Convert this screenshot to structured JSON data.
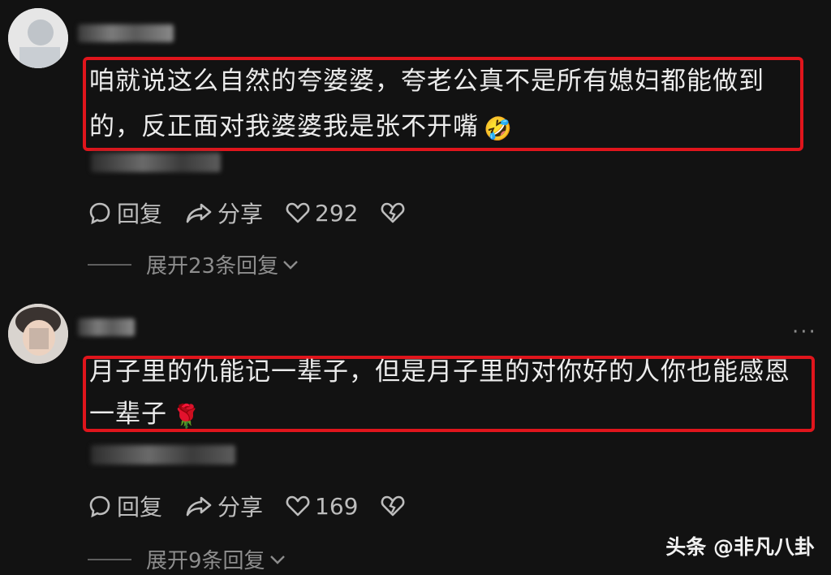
{
  "comments": [
    {
      "text_line1": "咱就说这么自然的夸婆婆，夸老公真不是所有媳妇都能做到",
      "text_line2": "的，反正面对我婆婆我是张不开嘴",
      "emoji": "🤣",
      "reply_label": "回复",
      "share_label": "分享",
      "likes": "292",
      "expand_replies": "展开23条回复"
    },
    {
      "text_line1": "月子里的仇能记一辈子，但是月子里的对你好的人你也能感恩",
      "text_line2": "一辈子",
      "emoji": "🌹",
      "reply_label": "回复",
      "share_label": "分享",
      "likes": "169",
      "expand_replies": "展开9条回复"
    }
  ],
  "more_icon": "···",
  "watermark": "头条 @非凡八卦",
  "colors": {
    "highlight": "#e0151c",
    "background": "#121212"
  }
}
